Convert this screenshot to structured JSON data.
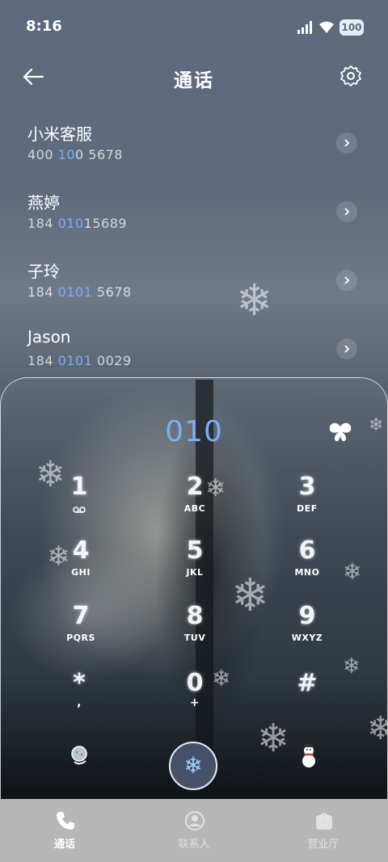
{
  "status_bar": {
    "time": "8:16",
    "battery": "100"
  },
  "header": {
    "title": "通话"
  },
  "contacts": [
    {
      "name": "小米客服",
      "number_parts": [
        "400",
        " 10",
        "0 5678"
      ],
      "highlight_index": 1
    },
    {
      "name": "燕婷",
      "number_parts": [
        "184 ",
        "010",
        "15689"
      ],
      "highlight_index": 1
    },
    {
      "name": "子玲",
      "number_parts": [
        "184 ",
        "0101",
        " 5678"
      ],
      "highlight_index": 1
    },
    {
      "name": "Jason",
      "number_parts": [
        "184 ",
        "0101",
        " 0029"
      ],
      "highlight_index": 1
    }
  ],
  "dialpad": {
    "entered": "010",
    "keys": [
      {
        "digit": "1",
        "letters": ""
      },
      {
        "digit": "2",
        "letters": "ABC"
      },
      {
        "digit": "3",
        "letters": "DEF"
      },
      {
        "digit": "4",
        "letters": "GHI"
      },
      {
        "digit": "5",
        "letters": "JKL"
      },
      {
        "digit": "6",
        "letters": "MNO"
      },
      {
        "digit": "7",
        "letters": "PQRS"
      },
      {
        "digit": "8",
        "letters": "TUV"
      },
      {
        "digit": "9",
        "letters": "WXYZ"
      },
      {
        "digit": "*",
        "letters": ","
      },
      {
        "digit": "0",
        "letters": "+"
      },
      {
        "digit": "#",
        "letters": ""
      }
    ]
  },
  "nav": {
    "tabs": [
      {
        "label": "通话",
        "icon": "phone-icon",
        "active": true
      },
      {
        "label": "联系人",
        "icon": "contacts-icon",
        "active": false
      },
      {
        "label": "营业厅",
        "icon": "store-bag-icon",
        "active": false
      }
    ]
  },
  "colors": {
    "accent": "#79aefc",
    "nav_bg": "#b7b7b7"
  }
}
